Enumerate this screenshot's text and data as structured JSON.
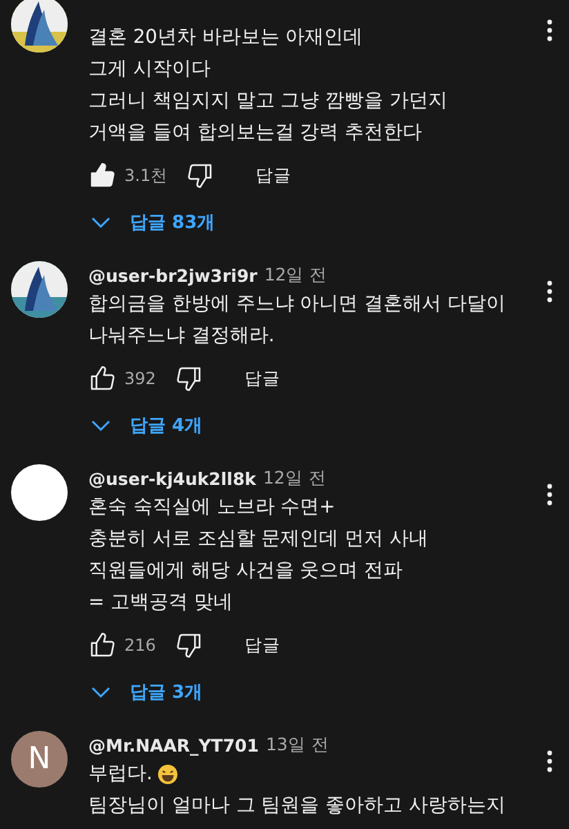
{
  "comments": [
    {
      "lines": [
        "결혼 20년차 바라보는 아재인데",
        "그게 시작이다",
        "그러니 책임지지 말고 그냥 깜빵을 가던지",
        "거액을 들여 합의보는걸 강력 추천한다"
      ],
      "liked": true,
      "likes": "3.1천",
      "reply_label": "답글",
      "replies": "답글 83개"
    },
    {
      "author": "@user-br2jw3ri9r",
      "time": "12일 전",
      "lines": [
        "합의금을 한방에 주느냐 아니면 결혼해서 다달이",
        "나눠주느냐 결정해라."
      ],
      "liked": false,
      "likes": "392",
      "reply_label": "답글",
      "replies": "답글 4개"
    },
    {
      "author": "@user-kj4uk2ll8k",
      "time": "12일 전",
      "avatar": {
        "kind": "blank",
        "color": "#ffffff"
      },
      "lines": [
        "혼숙 숙직실에 노브라 수면+",
        "충분히 서로 조심할 문제인데 먼저 사내",
        "직원들에게 해당 사건을 웃으며 전파",
        "= 고백공격 맞네"
      ],
      "liked": false,
      "likes": "216",
      "reply_label": "답글",
      "replies": "답글 3개"
    },
    {
      "author": "@Mr.NAAR_YT701",
      "time": "13일 전",
      "avatar": {
        "kind": "letter",
        "letter": "N",
        "color": "#9c7b6f"
      },
      "lines": [
        "부럽다.",
        "팀장님이 얼마나 그 팀원을 좋아하고 사랑하는지"
      ],
      "emoji": {
        "kind": "laughing"
      }
    }
  ]
}
